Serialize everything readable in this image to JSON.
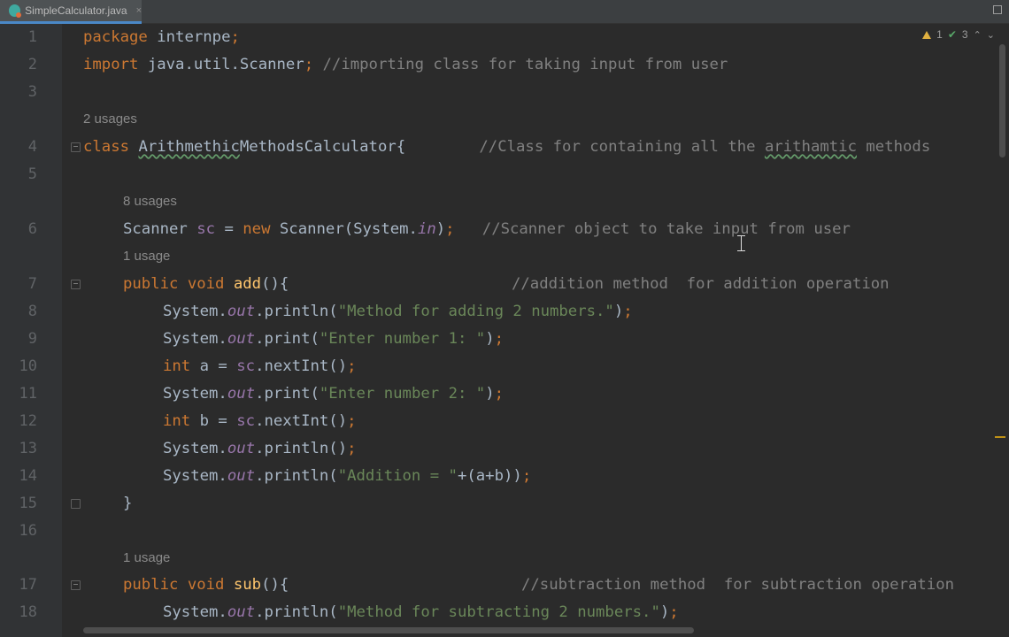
{
  "tab": {
    "label": "SimpleCalculator.java",
    "close": "×"
  },
  "inspections": {
    "warnings": "1",
    "weak_warnings": "3",
    "up": "⌃",
    "down": "⌄"
  },
  "usages": {
    "u1": "2 usages",
    "u2": "8 usages",
    "u3": "1 usage",
    "u4": "1 usage"
  },
  "lines": {
    "l1": {
      "num": "1",
      "kw": "package",
      "rest": " internpe",
      "semi": ";"
    },
    "l2": {
      "num": "2",
      "kw": "import",
      "rest": " java.util.Scanner",
      "semi": ";",
      "comment": " //importing class for taking input from user"
    },
    "l3": {
      "num": "3"
    },
    "l4": {
      "num": "4",
      "kw": "class",
      "sp": " ",
      "typo1": "Arithmethic",
      "rest": "MethodsCalculator{",
      "gap": "        ",
      "c1": "//Class for containing all the ",
      "typo2": "arithamtic",
      "c2": " methods"
    },
    "l5": {
      "num": "5"
    },
    "l6": {
      "num": "6",
      "a": "Scanner ",
      "fld": "sc",
      "b": " = ",
      "kw": "new",
      "c": " Scanner(System.",
      "st": "in",
      "d": ")",
      "semi": ";",
      "comment": "   //Scanner object to take input from user"
    },
    "l7": {
      "num": "7",
      "kw": "public void",
      "sp": " ",
      "fn": "add",
      "rest": "(){",
      "comment": "//addition method  for addition operation"
    },
    "l8": {
      "num": "8",
      "a": "System.",
      "st": "out",
      "b": ".println(",
      "str": "\"Method for adding 2 numbers.\"",
      "c": ")",
      "semi": ";"
    },
    "l9": {
      "num": "9",
      "a": "System.",
      "st": "out",
      "b": ".print(",
      "str": "\"Enter number 1: \"",
      "c": ")",
      "semi": ";"
    },
    "l10": {
      "num": "10",
      "kw": "int",
      "a": " a = ",
      "fld": "sc",
      "b": ".nextInt()",
      "semi": ";"
    },
    "l11": {
      "num": "11",
      "a": "System.",
      "st": "out",
      "b": ".print(",
      "str": "\"Enter number 2: \"",
      "c": ")",
      "semi": ";"
    },
    "l12": {
      "num": "12",
      "kw": "int",
      "a": " b = ",
      "fld": "sc",
      "b": ".nextInt()",
      "semi": ";"
    },
    "l13": {
      "num": "13",
      "a": "System.",
      "st": "out",
      "b": ".println()",
      "semi": ";"
    },
    "l14": {
      "num": "14",
      "a": "System.",
      "st": "out",
      "b": ".println(",
      "str": "\"Addition = \"",
      "c": "+(a+b))",
      "semi": ";"
    },
    "l15": {
      "num": "15",
      "a": "}"
    },
    "l16": {
      "num": "16"
    },
    "l17": {
      "num": "17",
      "kw": "public void",
      "sp": " ",
      "fn": "sub",
      "rest": "(){",
      "comment": "//subtraction method  for subtraction operation"
    },
    "l18": {
      "num": "18",
      "a": "System.",
      "st": "out",
      "b": ".println(",
      "str": "\"Method for subtracting 2 numbers.\"",
      "c": ")",
      "semi": ";"
    }
  }
}
